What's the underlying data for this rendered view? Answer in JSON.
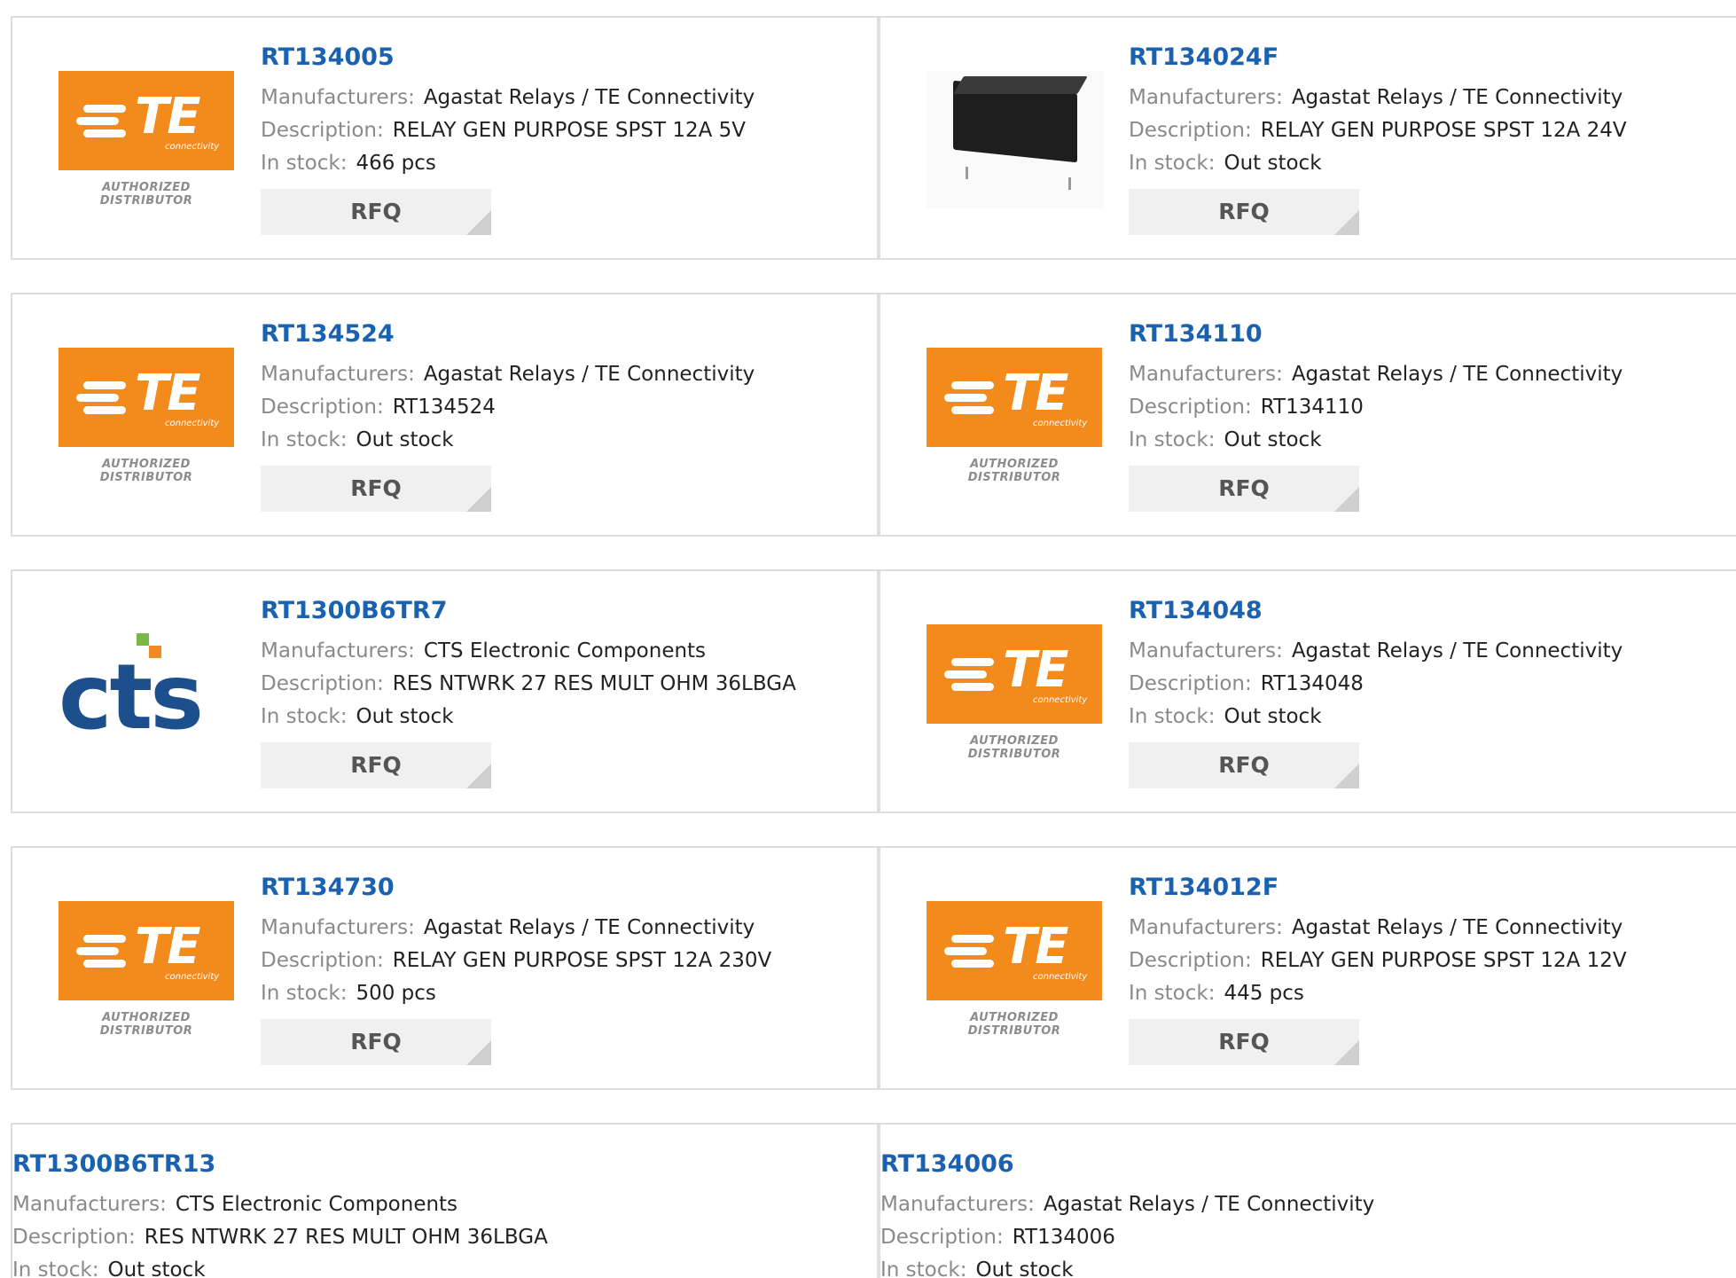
{
  "labels": {
    "manufacturers": "Manufacturers:",
    "description": "Description:",
    "stock": "In stock:",
    "rfq": "RFQ"
  },
  "logos": {
    "te_text": "TE",
    "te_sub": "connectivity",
    "te_authorized": "AUTHORIZED DISTRIBUTOR",
    "cts_text": "cts"
  },
  "products": [
    {
      "part": "RT134005",
      "manufacturer": "Agastat Relays / TE Connectivity",
      "description": "RELAY GEN PURPOSE SPST 12A 5V",
      "stock": "466 pcs",
      "image": "te-logo"
    },
    {
      "part": "RT134024F",
      "manufacturer": "Agastat Relays / TE Connectivity",
      "description": "RELAY GEN PURPOSE SPST 12A 24V",
      "stock": "Out stock",
      "image": "relay-photo"
    },
    {
      "part": "RT134524",
      "manufacturer": "Agastat Relays / TE Connectivity",
      "description": "RT134524",
      "stock": "Out stock",
      "image": "te-logo"
    },
    {
      "part": "RT134110",
      "manufacturer": "Agastat Relays / TE Connectivity",
      "description": "RT134110",
      "stock": "Out stock",
      "image": "te-logo"
    },
    {
      "part": "RT1300B6TR7",
      "manufacturer": "CTS Electronic Components",
      "description": "RES NTWRK 27 RES MULT OHM 36LBGA",
      "stock": "Out stock",
      "image": "cts-logo"
    },
    {
      "part": "RT134048",
      "manufacturer": "Agastat Relays / TE Connectivity",
      "description": "RT134048",
      "stock": "Out stock",
      "image": "te-logo"
    },
    {
      "part": "RT134730",
      "manufacturer": "Agastat Relays / TE Connectivity",
      "description": "RELAY GEN PURPOSE SPST 12A 230V",
      "stock": "500 pcs",
      "image": "te-logo"
    },
    {
      "part": "RT134012F",
      "manufacturer": "Agastat Relays / TE Connectivity",
      "description": "RELAY GEN PURPOSE SPST 12A 12V",
      "stock": "445 pcs",
      "image": "te-logo"
    },
    {
      "part": "RT1300B6TR13",
      "manufacturer": "CTS Electronic Components",
      "description": "RES NTWRK 27 RES MULT OHM 36LBGA",
      "stock": "Out stock",
      "image": "none"
    },
    {
      "part": "RT134006",
      "manufacturer": "Agastat Relays / TE Connectivity",
      "description": "RT134006",
      "stock": "Out stock",
      "image": "none"
    }
  ]
}
